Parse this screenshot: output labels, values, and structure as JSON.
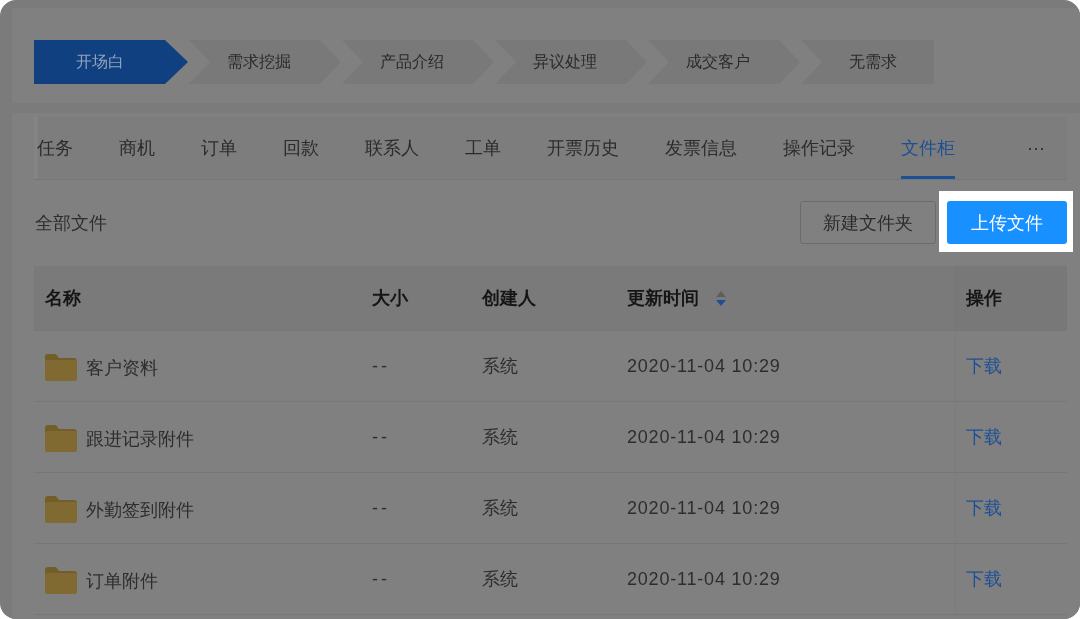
{
  "stages": [
    {
      "label": "开场白",
      "selected": true
    },
    {
      "label": "需求挖掘",
      "selected": false
    },
    {
      "label": "产品介绍",
      "selected": false
    },
    {
      "label": "异议处理",
      "selected": false
    },
    {
      "label": "成交客户",
      "selected": false
    },
    {
      "label": "无需求",
      "selected": false
    }
  ],
  "tabs": [
    {
      "label": "任务",
      "selected": false
    },
    {
      "label": "商机",
      "selected": false
    },
    {
      "label": "订单",
      "selected": false
    },
    {
      "label": "回款",
      "selected": false
    },
    {
      "label": "联系人",
      "selected": false
    },
    {
      "label": "工单",
      "selected": false
    },
    {
      "label": "开票历史",
      "selected": false
    },
    {
      "label": "发票信息",
      "selected": false
    },
    {
      "label": "操作记录",
      "selected": false
    },
    {
      "label": "文件柜",
      "selected": true
    }
  ],
  "more_tabs": "···",
  "toolbar": {
    "title": "全部文件",
    "buttons": [
      {
        "label": "新建文件夹",
        "kind": "default",
        "highlighted": false
      },
      {
        "label": "上传文件",
        "kind": "primary",
        "highlighted": true
      }
    ]
  },
  "table": {
    "columns": [
      {
        "label": "名称",
        "sortable": false
      },
      {
        "label": "大小",
        "sortable": false
      },
      {
        "label": "创建人",
        "sortable": false
      },
      {
        "label": "更新时间",
        "sortable": true,
        "sort_ascending": false,
        "sort_descending": true
      },
      {
        "label": "操作",
        "sortable": false
      }
    ],
    "rows": [
      {
        "name": "客户资料",
        "size": "--",
        "creator": "系统",
        "updated": "2020-11-04 10:29",
        "action": "下载"
      },
      {
        "name": "跟进记录附件",
        "size": "--",
        "creator": "系统",
        "updated": "2020-11-04 10:29",
        "action": "下载"
      },
      {
        "name": "外勤签到附件",
        "size": "--",
        "creator": "系统",
        "updated": "2020-11-04 10:29",
        "action": "下载"
      },
      {
        "name": "订单附件",
        "size": "--",
        "creator": "系统",
        "updated": "2020-11-04 10:29",
        "action": "下载"
      }
    ]
  }
}
